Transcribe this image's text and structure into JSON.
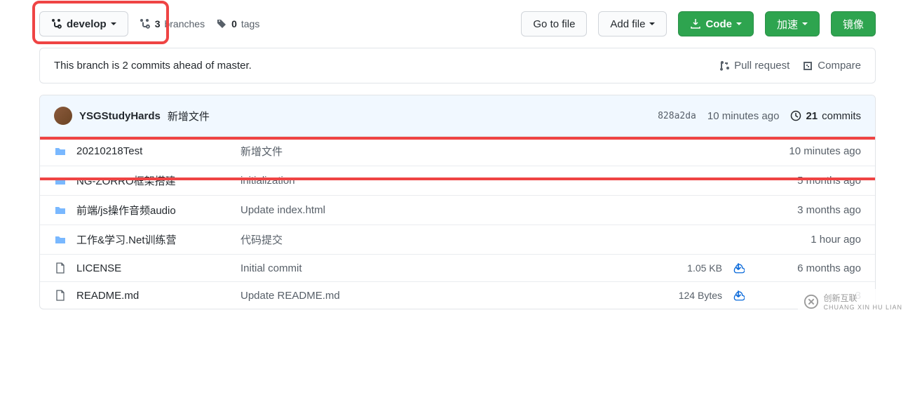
{
  "toolbar": {
    "branch": "develop",
    "branches_count": "3",
    "branches_label": "branches",
    "tags_count": "0",
    "tags_label": "tags",
    "goto": "Go to file",
    "add_file": "Add file",
    "code": "Code",
    "accel": "加速",
    "mirror": "镜像"
  },
  "status": {
    "text": "This branch is 2 commits ahead of master.",
    "pull_request": "Pull request",
    "compare": "Compare"
  },
  "commit": {
    "user": "YSGStudyHards",
    "message": "新增文件",
    "hash": "828a2da",
    "time": "10 minutes ago",
    "commits_count": "21",
    "commits_label": "commits"
  },
  "files": [
    {
      "type": "folder",
      "name": "20210218Test",
      "msg": "新增文件",
      "size": "",
      "dl": false,
      "time": "10 minutes ago",
      "hl": true
    },
    {
      "type": "folder",
      "name": "NG-ZORRO框架搭建",
      "msg": "initialization",
      "size": "",
      "dl": false,
      "time": "5 months ago",
      "hl": false
    },
    {
      "type": "folder",
      "name": "前端/js操作音频audio",
      "msg": "Update index.html",
      "size": "",
      "dl": false,
      "time": "3 months ago",
      "hl": false
    },
    {
      "type": "folder",
      "name": "工作&学习.Net训练营",
      "msg": "代码提交",
      "size": "",
      "dl": false,
      "time": "1 hour ago",
      "hl": false
    },
    {
      "type": "file",
      "name": "LICENSE",
      "msg": "Initial commit",
      "size": "1.05 KB",
      "dl": true,
      "time": "6 months ago",
      "hl": false
    },
    {
      "type": "file",
      "name": "README.md",
      "msg": "Update README.md",
      "size": "124 Bytes",
      "dl": true,
      "time": "3",
      "hl": false
    }
  ],
  "watermark": {
    "brand": "创新互联",
    "sub": "CHUANG XIN HU LIAN"
  }
}
